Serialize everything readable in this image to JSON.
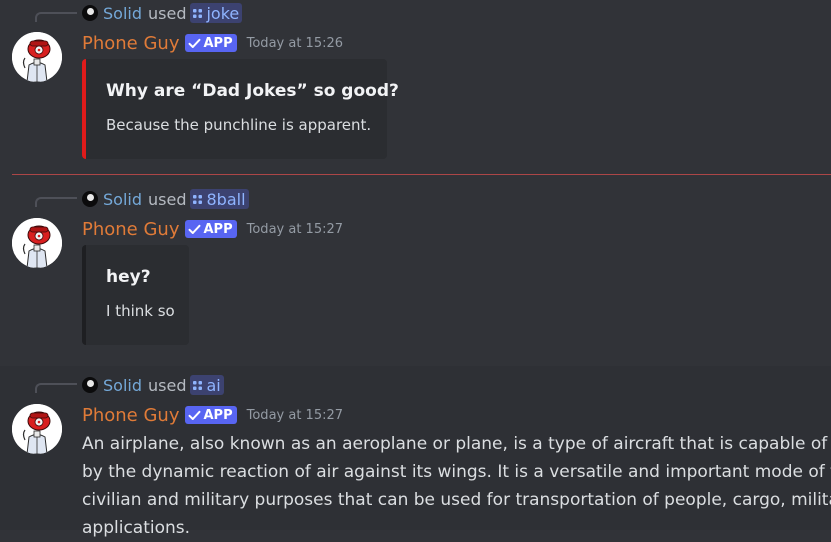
{
  "messages": [
    {
      "reply_user": "Solid",
      "reply_used": "used",
      "command": "joke",
      "username": "Phone Guy",
      "badge": "APP",
      "timestamp": "Today at 15:26",
      "embed_title": "Why are “Dad Jokes” so good?",
      "embed_description": "Because the punchline is apparent.",
      "embed_color": "#e01b1b"
    },
    {
      "reply_user": "Solid",
      "reply_used": "used",
      "command": "8ball",
      "username": "Phone Guy",
      "badge": "APP",
      "timestamp": "Today at 15:27",
      "embed_title": "hey?",
      "embed_description": "I think so",
      "embed_color": "#1e1f22"
    },
    {
      "reply_user": "Solid",
      "reply_used": "used",
      "command": "ai",
      "username": "Phone Guy",
      "badge": "APP",
      "timestamp": "Today at 15:27",
      "text_lines": [
        "An airplane, also known as an aeroplane or plane, is a type of aircraft that is capable of fl",
        "by the dynamic reaction of air against its wings. It is a versatile and important mode of tra",
        "civilian and military purposes that can be used for transportation of people, cargo, milita",
        "applications."
      ]
    }
  ],
  "colors": {
    "background": "#313338",
    "username": "#e07b38",
    "reply_user": "#74a8d8",
    "app_badge": "#5865f2",
    "new_messages_divider": "#c24a4a"
  }
}
